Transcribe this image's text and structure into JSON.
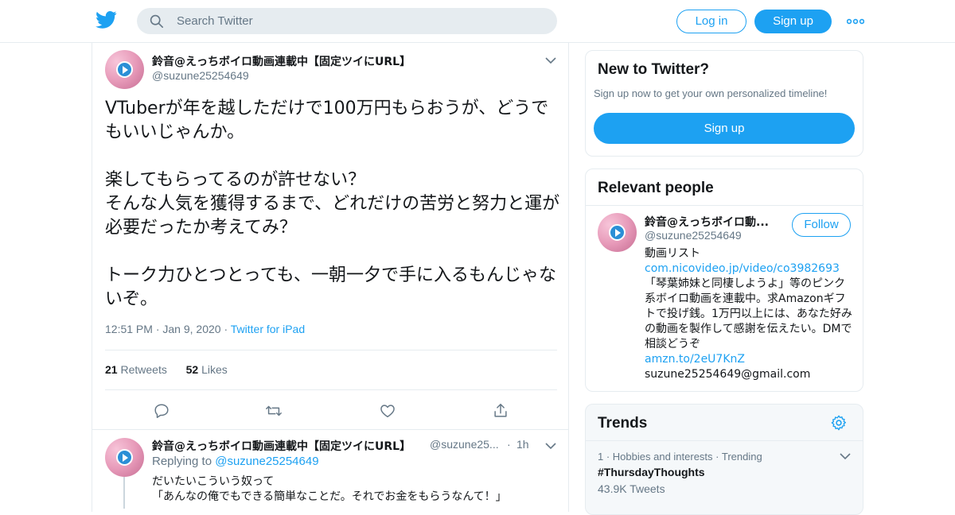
{
  "header": {
    "search_placeholder": "Search Twitter",
    "login_label": "Log in",
    "signup_label": "Sign up"
  },
  "tweet": {
    "name": "鈴音@えっちボイロ動画連載中【固定ツイにURL】",
    "handle": "@suzune25254649",
    "text": "VTuberが年を越しただけで100万円もらおうが、どうでもいいじゃんか。\n\n楽してもらってるのが許せない？\nそんな人気を獲得するまで、どれだけの苦労と努力と運が必要だったか考えてみ？\n\nトーク力ひとつとっても、一朝一夕で手に入るもんじゃないぞ。",
    "time": "12:51 PM",
    "date": "Jan 9, 2020",
    "source": "Twitter for iPad",
    "retweets_count": "21",
    "retweets_label": "Retweets",
    "likes_count": "52",
    "likes_label": "Likes"
  },
  "reply": {
    "name": "鈴音@えっちボイロ動画連載中【固定ツイにURL】",
    "handle": "@suzune25...",
    "age": "1h",
    "replying_label": "Replying to",
    "replying_to": "@suzune25254649",
    "line1": "だいたいこういう奴って",
    "line2": "「あんなの俺でもできる簡単なことだ。それでお金をもらうなんて！」"
  },
  "sidebar": {
    "new_title": "New to Twitter?",
    "new_subtitle": "Sign up now to get your own personalized timeline!",
    "signup_label": "Sign up",
    "relevant_title": "Relevant people",
    "person_name": "鈴音@えっちボイロ動...",
    "person_handle": "@suzune25254649",
    "follow_label": "Follow",
    "bio_line1": "動画リスト",
    "bio_link1": "com.nicovideo.jp/video/co3982693",
    "bio_after_link": "「琴葉姉妹と同棲しようよ」等のピンク系ボイロ動画を連載中。求Amazonギフトで投げ銭。1万円以上には、あなた好みの動画を製作して感謝を伝えたい。DMで相談どうぞ",
    "bio_link2": "amzn.to/2eU7KnZ",
    "bio_email": "suzune25254649@gmail.com",
    "trends_title": "Trends",
    "trend_rank": "1",
    "trend_category": "Hobbies and interests",
    "trend_status": "Trending",
    "trend_tag": "#ThursdayThoughts",
    "trend_count": "43.9K Tweets"
  },
  "colors": {
    "accent": "#1da1f2",
    "secondary_text": "#657786",
    "divider": "#e6ecf0",
    "trends_bg": "#f5f8fa"
  },
  "icons": [
    "twitter-logo-icon",
    "search-icon",
    "more-icon",
    "chevron-down-icon",
    "reply-icon",
    "retweet-icon",
    "like-icon",
    "share-icon",
    "gear-icon",
    "play-icon"
  ]
}
